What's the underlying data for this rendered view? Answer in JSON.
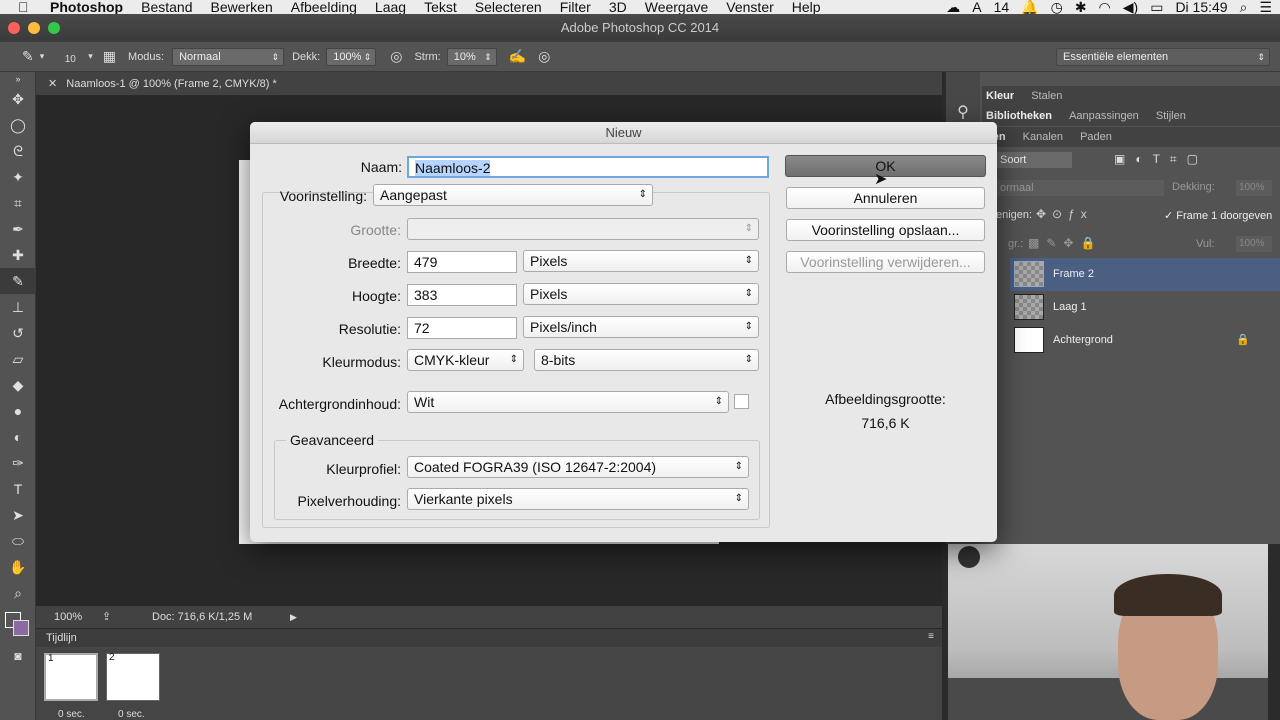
{
  "menubar": {
    "app": "Photoshop",
    "items": [
      "Bestand",
      "Bewerken",
      "Afbeelding",
      "Laag",
      "Tekst",
      "Selecteren",
      "Filter",
      "3D",
      "Weergave",
      "Venster",
      "Help"
    ],
    "badge": "14",
    "clock": "Di 15:49"
  },
  "window": {
    "title": "Adobe Photoshop CC 2014"
  },
  "options": {
    "brush_size": "10",
    "mode_label": "Modus:",
    "mode_value": "Normaal",
    "opacity_label": "Dekk:",
    "opacity_value": "100%",
    "flow_label": "Strm:",
    "flow_value": "10%",
    "workspace": "Essentiële elementen"
  },
  "document": {
    "tab": "Naamloos-1 @ 100% (Frame 2, CMYK/8) *",
    "zoom": "100%",
    "doc_info": "Doc: 716,6 K/1,25 M"
  },
  "timeline": {
    "title": "Tijdlijn",
    "frames": [
      {
        "num": "1",
        "delay": "0 sec."
      },
      {
        "num": "2",
        "delay": "0 sec."
      }
    ]
  },
  "panels": {
    "tabs_row1": [
      "Kleur",
      "Stalen"
    ],
    "tabs_row2": [
      "Bibliotheken",
      "Aanpassingen",
      "Stijlen"
    ],
    "tabs_row3": [
      "gen",
      "Kanalen",
      "Paden"
    ],
    "filter_label": "Soort",
    "blend_mode": "ormaal",
    "opacity_label": "Dekking:",
    "opacity_value": "100%",
    "unify_label": "enigen:",
    "propagate_label": "Frame 1 doorgeven",
    "lock_label": "gr.:",
    "fill_label": "Vul:",
    "fill_value": "100%",
    "layers": [
      {
        "name": "Frame 2"
      },
      {
        "name": "Laag 1"
      },
      {
        "name": "Achtergrond"
      }
    ]
  },
  "dialog": {
    "title": "Nieuw",
    "name_label": "Naam:",
    "name_value": "Naamloos-2",
    "preset_label": "Voorinstelling:",
    "preset_value": "Aangepast",
    "size_label": "Grootte:",
    "size_value": "",
    "width_label": "Breedte:",
    "width_value": "479",
    "width_unit": "Pixels",
    "height_label": "Hoogte:",
    "height_value": "383",
    "height_unit": "Pixels",
    "res_label": "Resolutie:",
    "res_value": "72",
    "res_unit": "Pixels/inch",
    "color_label": "Kleurmodus:",
    "color_mode": "CMYK-kleur",
    "color_bits": "8-bits",
    "bg_label": "Achtergrondinhoud:",
    "bg_value": "Wit",
    "advanced": "Geavanceerd",
    "profile_label": "Kleurprofiel:",
    "profile_value": "Coated FOGRA39 (ISO 12647-2:2004)",
    "pixel_label": "Pixelverhouding:",
    "pixel_value": "Vierkante pixels",
    "ok": "OK",
    "cancel": "Annuleren",
    "save_preset": "Voorinstelling opslaan...",
    "delete_preset": "Voorinstelling verwijderen...",
    "image_size_label": "Afbeeldingsgrootte:",
    "image_size_value": "716,6 K"
  }
}
